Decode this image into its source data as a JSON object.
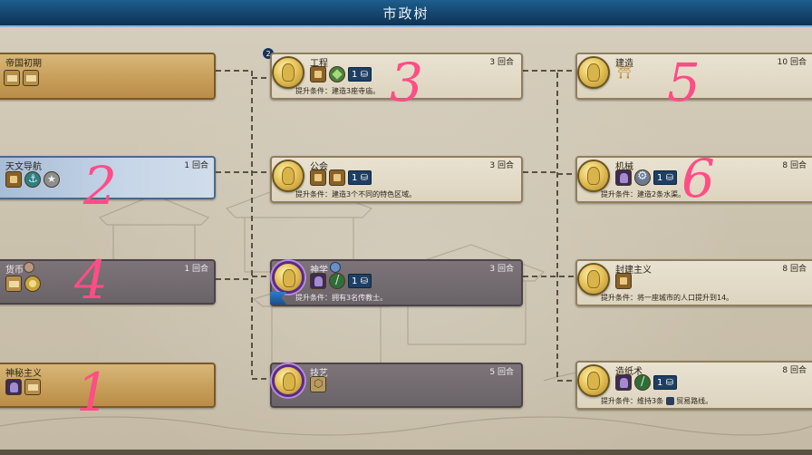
{
  "header": {
    "title": "市政树"
  },
  "left_column": [
    {
      "name": "帝国初期",
      "turns": "",
      "state": "done"
    },
    {
      "name": "天文导航",
      "turns": "1 回合",
      "state": "active"
    },
    {
      "name": "货币",
      "turns": "1 回合",
      "state": "grayp"
    },
    {
      "name": "神秘主义",
      "turns": "",
      "state": "done"
    }
  ],
  "middle_column": [
    {
      "name": "工程",
      "turns": "3 回合",
      "condition": "提升条件：建造3座寺庙。",
      "badge": "1"
    },
    {
      "name": "公会",
      "turns": "3 回合",
      "condition": "提升条件：建造3个不同的特色区域。",
      "badge": "1"
    },
    {
      "name": "神学",
      "turns": "3 回合",
      "condition": "提升条件：拥有3名传教士。",
      "badge": "1"
    },
    {
      "name": "技艺",
      "turns": "5 回合",
      "condition": "",
      "badge": ""
    }
  ],
  "right_column": [
    {
      "name": "建造",
      "turns": "10 回合",
      "condition": ""
    },
    {
      "name": "机械",
      "turns": "8 回合",
      "condition": "提升条件：建造2条水渠。",
      "badge": "1"
    },
    {
      "name": "封建主义",
      "turns": "8 回合",
      "condition": "提升条件：将一座城市的人口提升到14。"
    },
    {
      "name": "造纸术",
      "turns": "8 回合",
      "condition": "提升条件：维持3条",
      "condition_tail": "贸易路线。",
      "badge": "1"
    }
  ],
  "queue_marker": "2",
  "annotations": [
    "3",
    "2",
    "5",
    "6",
    "4",
    "1"
  ],
  "colors": {
    "header_blue": "#14436a",
    "card_parchment": "#e9e2d1",
    "card_gold": "#c69c57",
    "card_active": "#a7bcd6",
    "card_purple": "#6e6170",
    "badge_blue": "#1e3f63",
    "annotation_pink": "#ff4d86"
  }
}
